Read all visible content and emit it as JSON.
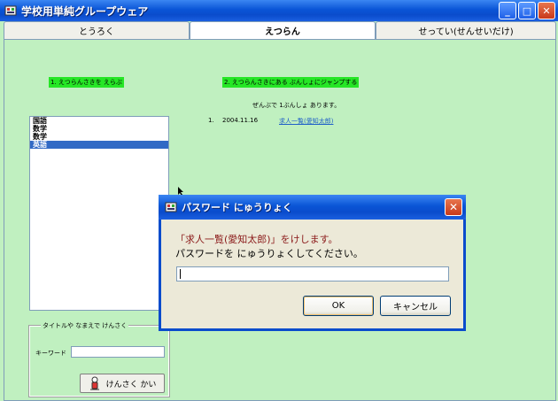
{
  "window": {
    "title": "学校用単純グループウェア",
    "minimize": "_",
    "maximize": "□",
    "close": "✕"
  },
  "tabs": [
    {
      "label": "とうろく"
    },
    {
      "label": "えつらん"
    },
    {
      "label": "せってい(せんせいだけ)"
    }
  ],
  "step1": "1. えつらんさきを えらぶ",
  "step2": "2. えつらんさきにある ぶんしょにジャンプする",
  "count_text": "ぜんぶで 1ぶんしょ あります。",
  "results": [
    {
      "index": "1.",
      "date": "2004.11.16",
      "link": "求人一覧(愛知太郎)"
    }
  ],
  "subjects": [
    {
      "label": "国語",
      "selected": false
    },
    {
      "label": "数学",
      "selected": false
    },
    {
      "label": "数学",
      "selected": false
    },
    {
      "label": "英語",
      "selected": true
    }
  ],
  "search": {
    "legend": "タイトルや なまえで けんさく",
    "keyword_label": "キーワード",
    "keyword_value": "",
    "button_label": "けんさく かい"
  },
  "dialog": {
    "title": "パスワード にゅうりょく",
    "message_line1": "「求人一覧(愛知太郎)」をけします。",
    "message_line2": "パスワードを にゅうりょくしてください。",
    "password_value": "",
    "ok_label": "OK",
    "cancel_label": "キャンセル",
    "close": "✕"
  },
  "colors": {
    "background": "#c0f0c0",
    "step_highlight": "#26e626",
    "selection": "#316ac5",
    "xp_blue": "#0a4ccc"
  }
}
